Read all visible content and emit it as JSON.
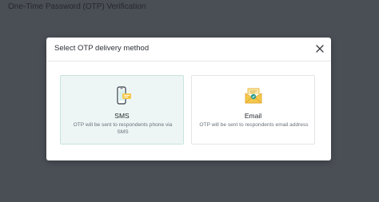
{
  "page": {
    "title": "One-Time Password (OTP) Verification"
  },
  "modal": {
    "title": "Select OTP delivery method",
    "close_icon": "close-icon",
    "options": [
      {
        "id": "sms",
        "label": "SMS",
        "description": "OTP will be sent to respondents phone via SMS",
        "icon": "mobile-phone-icon",
        "selected": true
      },
      {
        "id": "email",
        "label": "Email",
        "description": "OTP will be sent to respondents email address",
        "icon": "envelope-icon",
        "selected": false
      }
    ]
  },
  "colors": {
    "backdrop": "#4a4e55",
    "selected_bg": "#edf6f5",
    "selected_border": "#c9e3df",
    "icon_teal": "#2a9c8f",
    "icon_yellow": "#f5c84c"
  }
}
